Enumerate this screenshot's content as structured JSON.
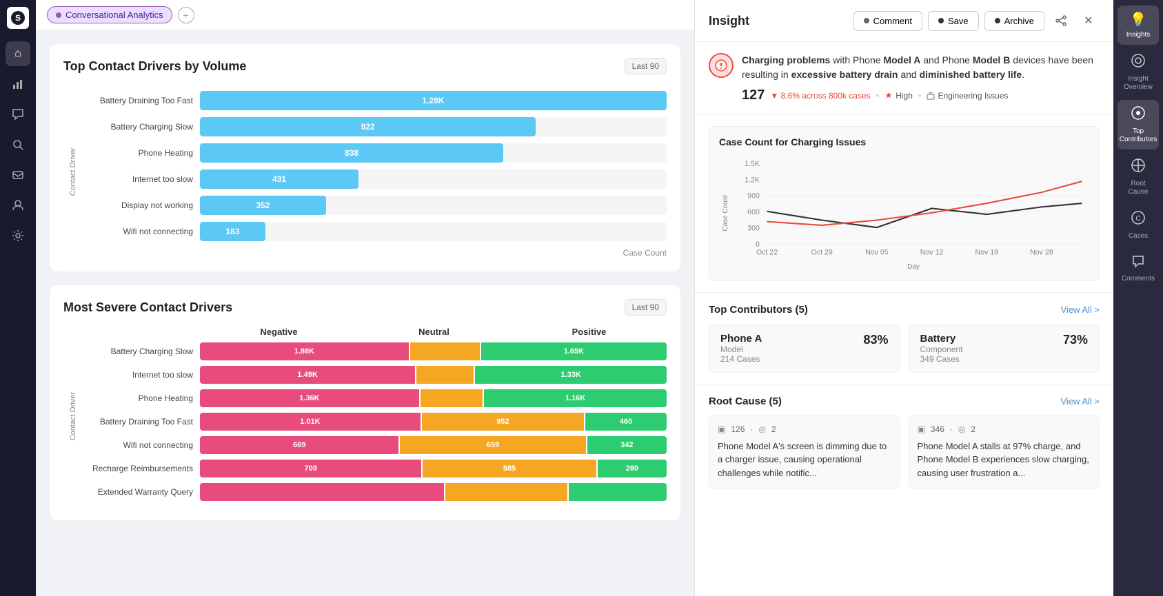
{
  "app": {
    "logo": "S",
    "tab_label": "Conversational Analytics",
    "add_tab": "+"
  },
  "left_sidebar": {
    "icons": [
      {
        "name": "home-icon",
        "glyph": "⌂",
        "active": true
      },
      {
        "name": "chart-icon",
        "glyph": "▐",
        "active": false
      },
      {
        "name": "chat-icon",
        "glyph": "💬",
        "active": false
      },
      {
        "name": "search-icon",
        "glyph": "🔍",
        "active": false
      },
      {
        "name": "message-icon",
        "glyph": "✉",
        "active": false
      },
      {
        "name": "user-icon",
        "glyph": "👤",
        "active": false
      },
      {
        "name": "settings-icon",
        "glyph": "⚙",
        "active": false
      }
    ]
  },
  "chart1": {
    "title": "Top Contact Drivers by Volume",
    "badge": "Last 90",
    "axis_label": "Contact Driver",
    "x_label": "Case Count",
    "bars": [
      {
        "label": "Battery Draining Too Fast",
        "value": "1.28K",
        "pct": 100
      },
      {
        "label": "Battery Charging Slow",
        "value": "922",
        "pct": 72
      },
      {
        "label": "Phone Heating",
        "value": "838",
        "pct": 65
      },
      {
        "label": "Internet too slow",
        "value": "431",
        "pct": 34
      },
      {
        "label": "Display not working",
        "value": "352",
        "pct": 27
      },
      {
        "label": "Wifi not connecting",
        "value": "183",
        "pct": 14
      }
    ]
  },
  "chart2": {
    "title": "Most Severe Contact Drivers",
    "badge": "Last 90",
    "headers": [
      "Negative",
      "Neutral",
      "Positive"
    ],
    "axis_label": "Contact Driver",
    "rows": [
      {
        "label": "Battery Charging Slow",
        "neg": "1.88K",
        "neu": "",
        "pos": "1.65K",
        "neg_pct": 45,
        "neu_pct": 15,
        "pos_pct": 40
      },
      {
        "label": "Internet too slow",
        "neg": "1.49K",
        "neu": "",
        "pos": "1.33K",
        "neg_pct": 45,
        "neu_pct": 12,
        "pos_pct": 40
      },
      {
        "label": "Phone Heating",
        "neg": "1.36K",
        "neu": "",
        "pos": "1.16K",
        "neg_pct": 42,
        "neu_pct": 12,
        "pos_pct": 35
      },
      {
        "label": "Battery Draining Too Fast",
        "neg": "1.01K",
        "neu": "952",
        "pos": "460",
        "neg_pct": 38,
        "neu_pct": 28,
        "pos_pct": 14
      },
      {
        "label": "Wifi not connecting",
        "neg": "669",
        "neu": "659",
        "pos": "342",
        "neg_pct": 30,
        "neu_pct": 28,
        "pos_pct": 12
      },
      {
        "label": "Recharge Reimbursements",
        "neg": "709",
        "neu": "585",
        "pos": "280",
        "neg_pct": 32,
        "neu_pct": 25,
        "pos_pct": 10
      },
      {
        "label": "Extended Warranty Query",
        "neg": "",
        "neu": "",
        "pos": "",
        "neg_pct": 20,
        "neu_pct": 10,
        "pos_pct": 8
      }
    ]
  },
  "insight_panel": {
    "title": "Insight",
    "buttons": {
      "comment": "Comment",
      "save": "Save",
      "archive": "Archive"
    },
    "alert": {
      "text_intro": "Charging problems",
      "text_mid1": " with Phone ",
      "text_model_a": "Model A",
      "text_mid2": " and Phone ",
      "text_model_b": "Model B",
      "text_end1": " devices have been resulting in ",
      "text_excessive": "excessive battery drain",
      "text_end2": " and ",
      "text_diminished": "diminished battery life",
      "text_period": ".",
      "count": "127",
      "trend": "▼ 8.6% across 800k cases",
      "priority": "High",
      "category": "Engineering Issues"
    },
    "mini_chart": {
      "title": "Case Count for Charging Issues",
      "y_labels": [
        "1.5K",
        "1.2K",
        "900",
        "600",
        "300",
        "0"
      ],
      "x_labels": [
        "Oct 22",
        "Oct 29",
        "Nov 05",
        "Nov 12",
        "Nov 19",
        "Nov 28"
      ],
      "y_axis": "Case Count",
      "x_axis": "Day"
    },
    "contributors": {
      "title": "Top Contributors (5)",
      "view_all": "View All >",
      "cards": [
        {
          "name": "Phone A",
          "type": "Model",
          "pct": "83%",
          "cases": "214 Cases"
        },
        {
          "name": "Battery",
          "type": "Component",
          "pct": "73%",
          "cases": "349 Cases"
        }
      ]
    },
    "root_cause": {
      "title": "Root Cause (5)",
      "view_all": "View All >",
      "cards": [
        {
          "count1": "126",
          "count2": "2",
          "text": "Phone Model A's screen is dimming due to a charger issue, causing operational challenges while notific..."
        },
        {
          "count1": "346",
          "count2": "2",
          "text": "Phone Model A stalls at 97% charge, and Phone Model B experiences slow charging, causing user frustration a..."
        }
      ]
    }
  },
  "right_edge": {
    "items": [
      {
        "name": "insights-icon",
        "glyph": "💡",
        "label": "Insights",
        "active": true
      },
      {
        "name": "insight-overview-icon",
        "glyph": "◎",
        "label": "Insight Overview",
        "active": false
      },
      {
        "name": "top-contributors-edge-icon",
        "glyph": "⊙",
        "label": "Top Contributors",
        "active": true
      },
      {
        "name": "root-cause-edge-icon",
        "glyph": "⊗",
        "label": "Root Cause",
        "active": false
      },
      {
        "name": "cases-edge-icon",
        "glyph": "⊕",
        "label": "Cases",
        "active": false
      },
      {
        "name": "comments-edge-icon",
        "glyph": "💬",
        "label": "Comments",
        "active": false
      }
    ]
  }
}
